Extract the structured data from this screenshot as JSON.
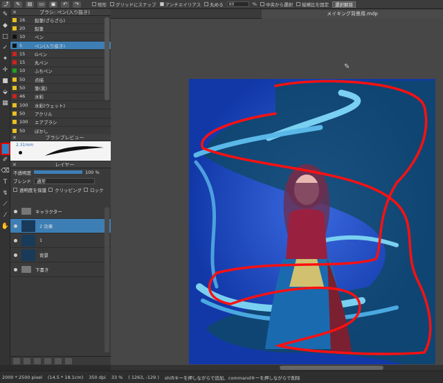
{
  "app": {
    "document_tab": "メイキング背景用.mdp"
  },
  "toolbar": {
    "shape": "矩形",
    "grid_snap": "グリッドにスナップ",
    "antialias": "アンチエイリアス",
    "round": "丸める",
    "round_value": "60",
    "percent": "%",
    "center_select": "中央から選択",
    "keep_ratio": "縦横比を固定",
    "select_button": "選択解除"
  },
  "brush_panel": {
    "title": "ブラシ: ペン(入り抜き)",
    "items": [
      {
        "size": "16",
        "name": "鉛筆(ざらざら)",
        "color": "#e8c020"
      },
      {
        "size": "20",
        "name": "鉛筆",
        "color": "#e8c020"
      },
      {
        "size": "10",
        "name": "ペン",
        "color": "#111111"
      },
      {
        "size": "5",
        "name": "ペン(入り抜き)",
        "color": "#111111",
        "selected": true
      },
      {
        "size": "15",
        "name": "Gペン",
        "color": "#d02020"
      },
      {
        "size": "15",
        "name": "丸ペン",
        "color": "#d02020"
      },
      {
        "size": "10",
        "name": "ふちペン",
        "color": "#20a020"
      },
      {
        "size": "50",
        "name": "点描",
        "color": "#e8c020"
      },
      {
        "size": "50",
        "name": "筆(黒)",
        "color": "#e8c020"
      },
      {
        "size": "46",
        "name": "水彩",
        "color": "#d02020"
      },
      {
        "size": "100",
        "name": "水彩(ウェット)",
        "color": "#e8c020"
      },
      {
        "size": "50",
        "name": "アクリル",
        "color": "#e8c020"
      },
      {
        "size": "100",
        "name": "エアブラシ",
        "color": "#e8c020"
      },
      {
        "size": "50",
        "name": "ぼかし",
        "color": "#e8c020"
      }
    ]
  },
  "brush_preview": {
    "title": "ブラシプレビュー",
    "size_label": "2.31mm"
  },
  "layer_panel": {
    "title": "レイヤー",
    "opacity_label": "不透明度",
    "opacity_value": "100 %",
    "blend_label": "ブレンド",
    "blend_value": "通常",
    "protect_label": "透明度を保護",
    "clipping_label": "クリッピング",
    "lock_label": "ロック",
    "layers": [
      {
        "name": "キャラクター",
        "type": "folder"
      },
      {
        "name": "2 効果",
        "type": "layer",
        "selected": true
      },
      {
        "name": "1",
        "type": "layer"
      },
      {
        "name": "背景",
        "type": "layer"
      },
      {
        "name": "下書き",
        "type": "folder"
      }
    ]
  },
  "status": {
    "size": "2000 * 2500 pixel",
    "physical": "(14.5 * 18.1cm)",
    "dpi": "350 dpi",
    "zoom": "33 %",
    "coords": "( 1263, -129 )",
    "hint": "shiftキーを押しながらで追加、commandキーを押しながらで削除"
  },
  "colors": {
    "accent": "#3d7fb5",
    "canvas_bg": "#1740b0",
    "red_marker": "#ff0000"
  }
}
